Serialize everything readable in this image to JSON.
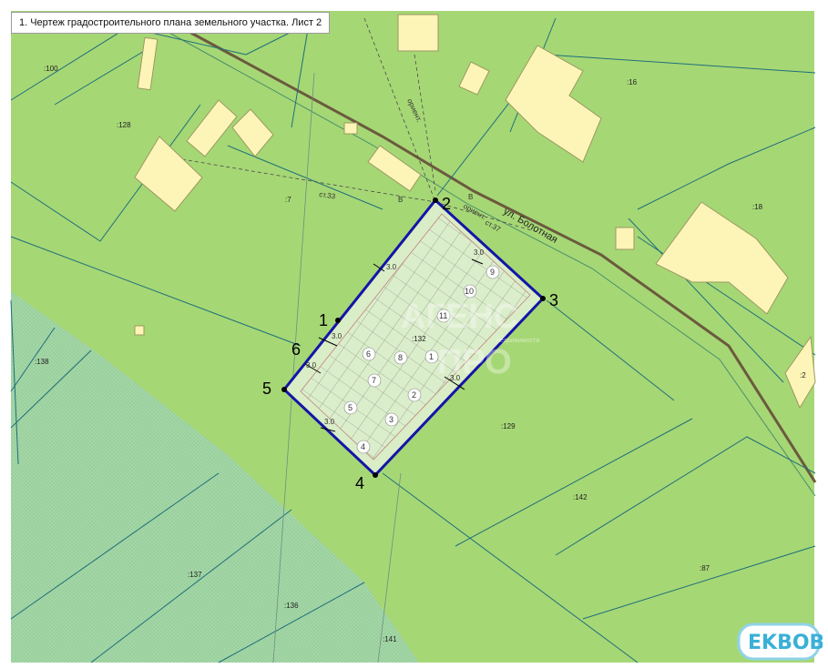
{
  "title": "1. Чертеж градостроительного плана земельного участка. Лист 2",
  "street": "ул. Болотная",
  "plot_numbers": [
    ":100",
    ":128",
    ":7",
    ":16",
    ":18",
    ":138",
    ":132",
    ":129",
    ":142",
    ":137",
    ":136",
    ":141",
    ":87",
    ":2"
  ],
  "vertex_labels": [
    "1",
    "2",
    "3",
    "4",
    "5",
    "6"
  ],
  "building_numbers": [
    "1",
    "2",
    "3",
    "4",
    "5",
    "6",
    "7",
    "8",
    "9",
    "10",
    "11"
  ],
  "dimension_labels": [
    "3.0",
    "3.0",
    "3.0",
    "3.0",
    "3.0",
    "3.0"
  ],
  "annotations": [
    "ст.33",
    "ст.37",
    "В",
    "В",
    "ориент.",
    "ориент."
  ],
  "watermark": [
    "АГЕНС",
    "ПРО",
    "недвижимости"
  ],
  "badge": "EKBOB",
  "colors": {
    "land": "#a6d775",
    "hatched": "#9fd0a4",
    "building": "#fdf4b7",
    "boundary": "#1414a8",
    "plot_lines": "#1e6f7a",
    "road": "#6b5a3e",
    "build_zone": "#d9edc6"
  }
}
